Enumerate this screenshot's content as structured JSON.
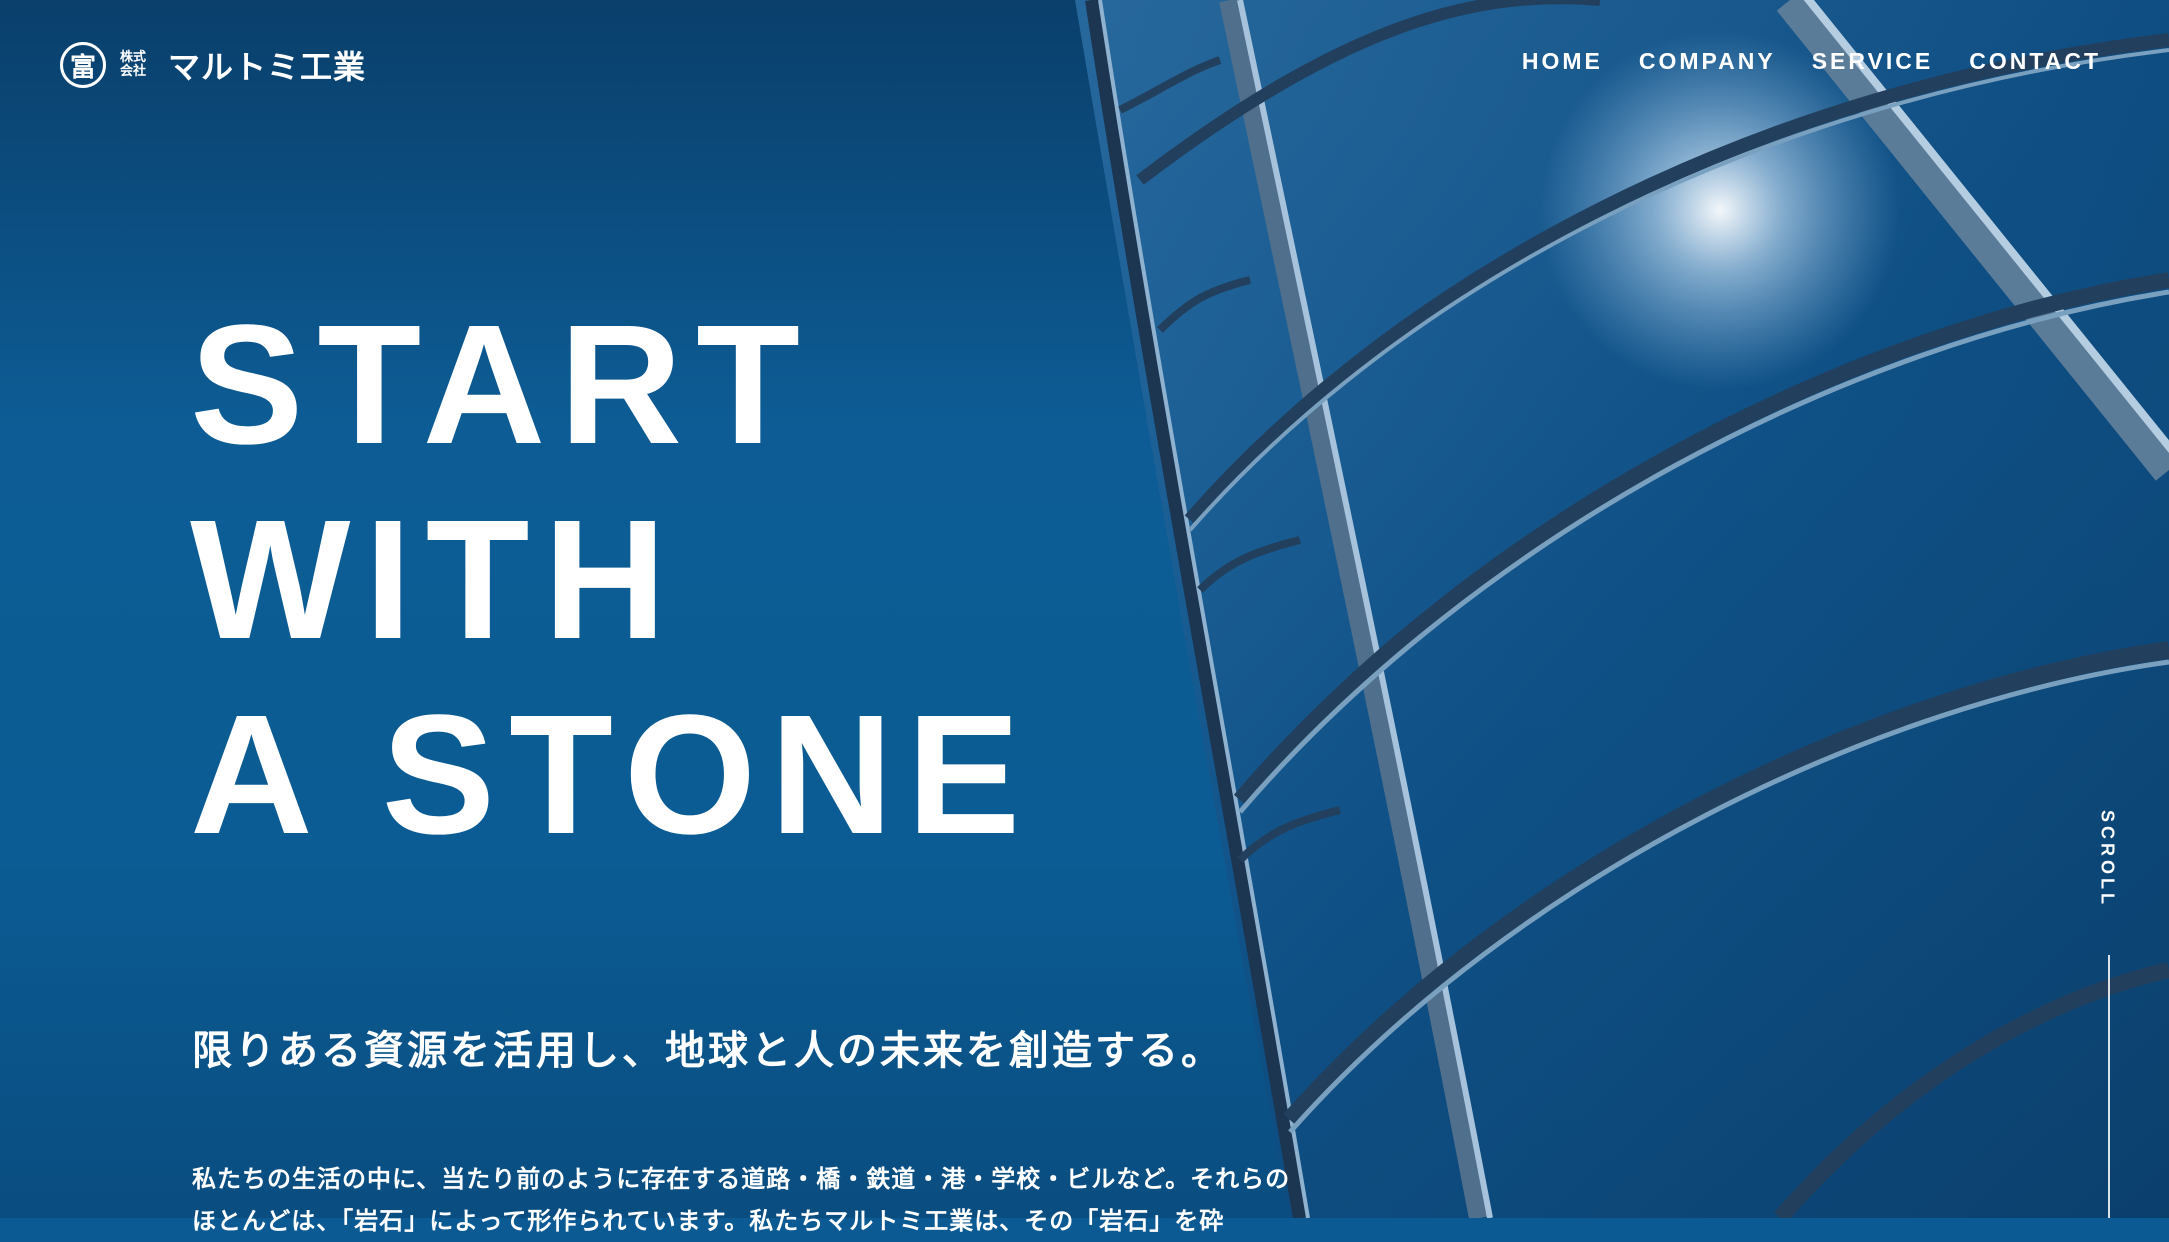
{
  "brand": {
    "mark": "富",
    "kabu": "株式会社",
    "name": "マルトミ工業"
  },
  "nav": {
    "items": [
      "HOME",
      "COMPANY",
      "SERVICE",
      "CONTACT"
    ]
  },
  "hero": {
    "lines": [
      "START",
      "WITH",
      "A STONE"
    ],
    "tagline": "限りある資源を活用し、地球と人の未来を創造する。",
    "body": "私たちの生活の中に、当たり前のように存在する道路・橋・鉄道・港・学校・ビルなど。それらのほとんどは、「岩石」によって形作られています。私たちマルトミ工業は、その「岩石」を砕"
  },
  "scroll": {
    "label": "SCROLL"
  }
}
